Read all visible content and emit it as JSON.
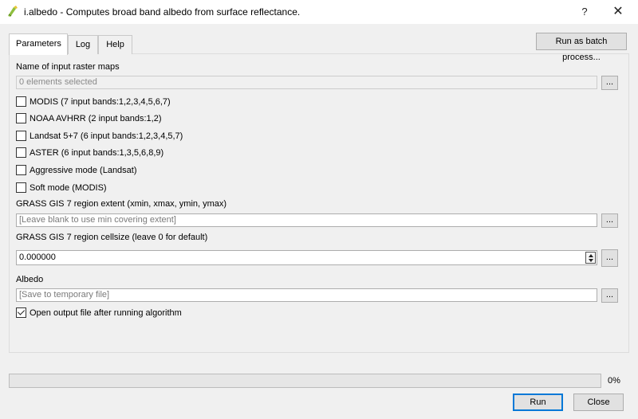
{
  "window": {
    "title": "i.albedo - Computes broad band albedo from surface reflectance.",
    "help_glyph": "?",
    "close_glyph": "✕",
    "icon": "qgis-logo-icon"
  },
  "tabs": [
    {
      "label": "Parameters",
      "active": true
    },
    {
      "label": "Log",
      "active": false
    },
    {
      "label": "Help",
      "active": false
    }
  ],
  "batch_button": "Run as batch process...",
  "params": {
    "input_label": "Name of input raster maps",
    "input_value": "0 elements selected",
    "browse": "...",
    "checkboxes": [
      {
        "label": "MODIS (7 input bands:1,2,3,4,5,6,7)",
        "checked": false
      },
      {
        "label": "NOAA AVHRR (2 input bands:1,2)",
        "checked": false
      },
      {
        "label": "Landsat 5+7 (6 input bands:1,2,3,4,5,7)",
        "checked": false
      },
      {
        "label": "ASTER (6 input bands:1,3,5,6,8,9)",
        "checked": false
      },
      {
        "label": "Aggressive mode (Landsat)",
        "checked": false
      },
      {
        "label": "Soft mode (MODIS)",
        "checked": false
      }
    ],
    "region_label": "GRASS GIS 7 region extent (xmin, xmax, ymin, ymax)",
    "region_placeholder": "[Leave blank to use min covering extent]",
    "cellsize_label": "GRASS GIS 7 region cellsize (leave 0 for default)",
    "cellsize_value": "0.000000",
    "albedo_label": "Albedo",
    "albedo_placeholder": "[Save to temporary file]",
    "open_output_label": "Open output file after running algorithm",
    "open_output_checked": true
  },
  "progress": {
    "value": 0,
    "text": "0%"
  },
  "buttons": {
    "run": "Run",
    "close": "Close"
  }
}
